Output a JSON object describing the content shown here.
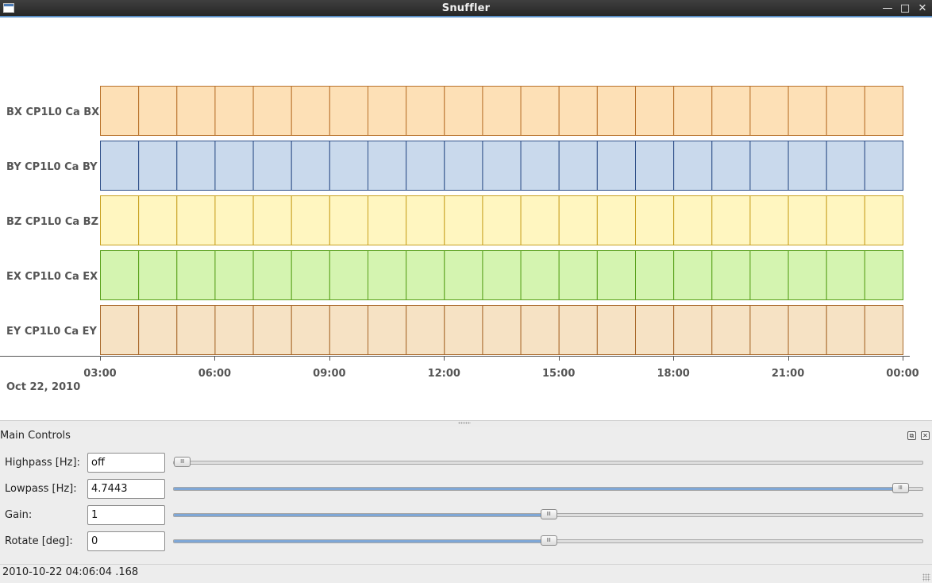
{
  "window": {
    "title": "Snuffler",
    "icons": {
      "app": "window-icon",
      "minimize": "minimize-icon",
      "maximize": "maximize-icon",
      "close": "close-icon"
    }
  },
  "traces": [
    {
      "label": "BX CP1L0 Ca BX",
      "fill": "#fde0b6",
      "stroke": "#b8712a"
    },
    {
      "label": "BY CP1L0 Ca BY",
      "fill": "#c9d9ec",
      "stroke": "#2e4f88"
    },
    {
      "label": "BZ CP1L0 Ca BZ",
      "fill": "#fff6c0",
      "stroke": "#c8a020"
    },
    {
      "label": "EX CP1L0 Ca EX",
      "fill": "#d4f4b0",
      "stroke": "#58a01a"
    },
    {
      "label": "EY CP1L0 Ca EY",
      "fill": "#f6e2c4",
      "stroke": "#a8682a"
    }
  ],
  "time_axis": {
    "ticks": [
      "03:00",
      "06:00",
      "09:00",
      "12:00",
      "15:00",
      "18:00",
      "21:00",
      "00:00"
    ],
    "date": "Oct 22, 2010"
  },
  "chart_data": {
    "type": "table",
    "segments_per_trace": 21,
    "x_range": [
      "03:00",
      "00:00"
    ]
  },
  "controls": {
    "title": "Main Controls",
    "dock_icons": [
      "float-icon",
      "close-panel-icon"
    ],
    "rows": [
      {
        "label": "Highpass [Hz]:",
        "value": "off",
        "slider_fraction": 0.0,
        "filled": false
      },
      {
        "label": "Lowpass [Hz]:",
        "value": "4.7443",
        "slider_fraction": 0.98,
        "filled": true
      },
      {
        "label": "Gain:",
        "value": "1",
        "slider_fraction": 0.5,
        "filled": true
      },
      {
        "label": "Rotate [deg]:",
        "value": "0",
        "slider_fraction": 0.5,
        "filled": true
      }
    ],
    "handle_glyph": "III"
  },
  "status": {
    "text": "2010-10-22 04:06:04 .168"
  }
}
